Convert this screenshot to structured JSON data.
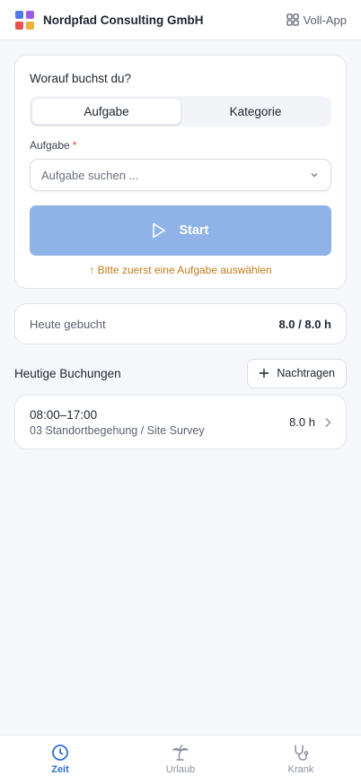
{
  "header": {
    "company": "Nordpfad Consulting GmbH",
    "full_app_label": "Voll-App",
    "logo_colors": [
      "#4f7be8",
      "#9a5be6",
      "#e9534f",
      "#f0b03a"
    ]
  },
  "booking_form": {
    "question": "Worauf buchst du?",
    "tabs": [
      {
        "label": "Aufgabe",
        "active": true
      },
      {
        "label": "Kategorie",
        "active": false
      }
    ],
    "task_label": "Aufgabe",
    "required_marker": "*",
    "task_placeholder": "Aufgabe suchen ...",
    "start_label": "Start",
    "hint": "Bitte zuerst eine Aufgabe auswählen"
  },
  "today": {
    "label": "Heute gebucht",
    "value": "8.0 / 8.0 h"
  },
  "bookings": {
    "title": "Heutige Buchungen",
    "add_label": "Nachtragen",
    "items": [
      {
        "time": "08:00–17:00",
        "description": "03 Standortbegehung / Site Survey",
        "duration": "8.0 h"
      }
    ]
  },
  "nav": {
    "items": [
      {
        "label": "Zeit",
        "icon": "clock-icon",
        "active": true
      },
      {
        "label": "Urlaub",
        "icon": "palm-tree-icon",
        "active": false
      },
      {
        "label": "Krank",
        "icon": "stethoscope-icon",
        "active": false
      }
    ]
  },
  "colors": {
    "accent": "#2f6fd6",
    "start_button_disabled": "#8fb3e6",
    "hint": "#c27b1c",
    "required": "#e04848"
  }
}
